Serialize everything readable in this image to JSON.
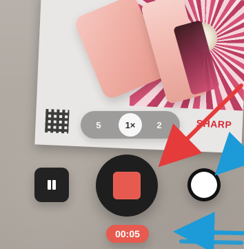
{
  "viewfinder": {
    "brand_logo": "SHARP"
  },
  "zoom": {
    "options": [
      {
        "label": "5",
        "selected": false
      },
      {
        "label": "1×",
        "selected": true
      },
      {
        "label": "2",
        "selected": false
      }
    ]
  },
  "recording": {
    "timer": "00:05"
  },
  "icons": {
    "pause": "pause-icon",
    "stop": "stop-icon",
    "photo": "shutter-circle-icon"
  },
  "colors": {
    "record_red": "#e65a4f",
    "arrow_red": "#e53b3b",
    "arrow_blue": "#1c9bd8"
  }
}
